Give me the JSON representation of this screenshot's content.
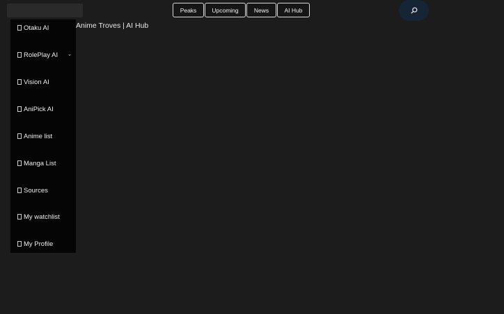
{
  "header": {
    "search": {
      "value": "",
      "placeholder": ""
    },
    "tabs": [
      {
        "label": "Peaks"
      },
      {
        "label": "Upcoming"
      },
      {
        "label": "News"
      },
      {
        "label": "AI Hub"
      }
    ],
    "search_button_icon": "search-icon"
  },
  "sidebar": {
    "items": [
      {
        "label": "Otaku AI",
        "icon": "box-icon"
      },
      {
        "label": "RolePlay AI",
        "icon": "box-icon",
        "has_submenu": true
      },
      {
        "label": "Vision AI",
        "icon": "box-icon"
      },
      {
        "label": "AniPick AI",
        "icon": "box-icon"
      },
      {
        "label": "Anime list",
        "icon": "box-icon"
      },
      {
        "label": "Manga List",
        "icon": "box-icon"
      },
      {
        "label": "Sources",
        "icon": "box-icon"
      },
      {
        "label": "My watchlist",
        "icon": "box-icon"
      },
      {
        "label": "My Profile",
        "icon": "box-icon"
      }
    ]
  },
  "main": {
    "heading": "Anime Troves | AI Hub"
  },
  "colors": {
    "background": "#1c1c1c",
    "sidebar": "#050505",
    "search_button": "#162536",
    "tab_border": "#d9d9d9"
  }
}
